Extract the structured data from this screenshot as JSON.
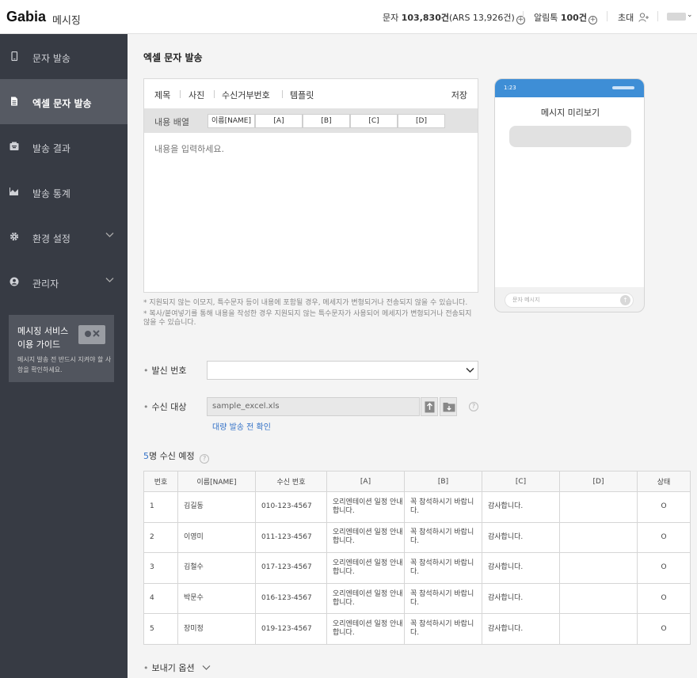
{
  "header": {
    "logo": "Gabia",
    "logo_sub": "메시징",
    "sms_label": "문자",
    "sms_count": "103,830건",
    "ars": "(ARS 13,926건)",
    "alimtalk_label": "알림톡",
    "alimtalk_count": "100건",
    "invite": "초대"
  },
  "sidebar": {
    "items": [
      {
        "label": "문자 발송"
      },
      {
        "label": "엑셀 문자 발송"
      },
      {
        "label": "발송 결과"
      },
      {
        "label": "발송 통계"
      },
      {
        "label": "환경 설정"
      },
      {
        "label": "관리자"
      }
    ],
    "guide": {
      "title1": "메시징 서비스",
      "title2": "이용 가이드",
      "desc": "메시지 발송 전 반드시 지켜야 할 사항을 확인하세요."
    }
  },
  "main": {
    "title": "엑셀 문자 발송",
    "editor": {
      "tabs": [
        "제목",
        "사진",
        "수신거부번호",
        "템플릿"
      ],
      "save": "저장",
      "var_label": "내용 배열",
      "vars": [
        "이름[NAME]",
        "[A]",
        "[B]",
        "[C]",
        "[D]"
      ],
      "placeholder": "내용을 입력하세요."
    },
    "notes": [
      "*  지원되지 않는 이모지, 특수문자 등이 내용에 포함될 경우, 메세지가 변형되거나 전송되지 않을 수 있습니다.",
      "*  복사/붙여넣기를 통해 내용을 작성한 경우 지원되지 않는 특수문자가 사용되어 메세지가 변형되거나 전송되지 않을 수 있습니다."
    ],
    "preview": {
      "time": "1:23",
      "title": "메시지 미리보기",
      "input_ph": "문자 메시지"
    },
    "sender_label": "발신 번호",
    "recipient_label": "수신 대상",
    "file_name": "sample_excel.xls",
    "bulk_link": "대량 발송 전 확인",
    "count_num": "5",
    "count_text": "명 수신 예정",
    "table": {
      "headers": [
        "번호",
        "이름[NAME]",
        "수신 번호",
        "[A]",
        "[B]",
        "[C]",
        "[D]",
        "상태"
      ],
      "rows": [
        [
          "1",
          "김길동",
          "010-123-4567",
          "오리엔테이션 일정 안내 합니다.",
          "꼭 참석하시기 바랍니다.",
          "감사합니다.",
          "",
          "O"
        ],
        [
          "2",
          "이영미",
          "011-123-4567",
          "오리엔테이션 일정 안내 합니다.",
          "꼭 참석하시기 바랍니다.",
          "감사합니다.",
          "",
          "O"
        ],
        [
          "3",
          "김철수",
          "017-123-4567",
          "오리엔테이션 일정 안내 합니다.",
          "꼭 참석하시기 바랍니다.",
          "감사합니다.",
          "",
          "O"
        ],
        [
          "4",
          "박문수",
          "016-123-4567",
          "오리엔테이션 일정 안내 합니다.",
          "꼭 참석하시기 바랍니다.",
          "감사합니다.",
          "",
          "O"
        ],
        [
          "5",
          "장미정",
          "019-123-4567",
          "오리엔테이션 일정 안내 합니다.",
          "꼭 참석하시기 바랍니다.",
          "감사합니다.",
          "",
          "O"
        ]
      ]
    },
    "send_options": "보내기 옵션"
  },
  "colors": {
    "sidebar_bg": "#373b44",
    "sidebar_active": "#565a63",
    "accent": "#3472c7",
    "phone_bar": "#3e8ed6"
  }
}
